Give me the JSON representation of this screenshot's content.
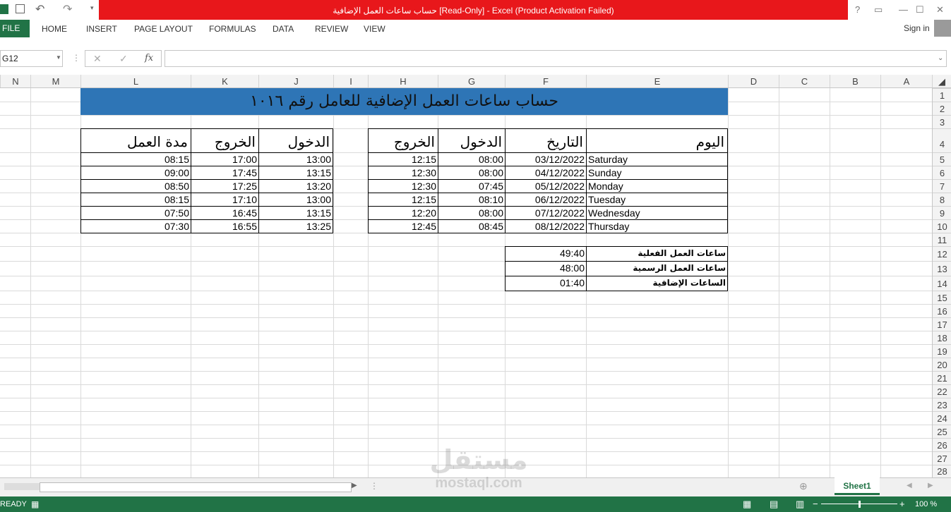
{
  "window": {
    "title": "حساب ساعات العمل الإضافية  [Read-Only]  -  Excel (Product Activation Failed)",
    "help": "?",
    "sign_in": "Sign in"
  },
  "ribbon": {
    "tabs": [
      "FILE",
      "HOME",
      "INSERT",
      "PAGE LAYOUT",
      "FORMULAS",
      "DATA",
      "REVIEW",
      "VIEW"
    ]
  },
  "formula_bar": {
    "name_box": "G12",
    "cancel_glyph": "✕",
    "enter_glyph": "✓",
    "fx_label": "fx",
    "value": ""
  },
  "columns": [
    "N",
    "M",
    "L",
    "K",
    "J",
    "I",
    "H",
    "G",
    "F",
    "E",
    "D",
    "C",
    "B",
    "A"
  ],
  "rows": [
    "1",
    "2",
    "3",
    "4",
    "5",
    "6",
    "7",
    "8",
    "9",
    "10",
    "11",
    "12",
    "13",
    "14",
    "15",
    "16",
    "17",
    "18",
    "19",
    "20",
    "21",
    "22",
    "23",
    "24",
    "25",
    "26",
    "27",
    "28"
  ],
  "sheet": {
    "banner": "حساب ساعات العمل الإضافية للعامل رقم ١٠١٦",
    "right_table": {
      "headers": [
        "اليوم",
        "التاريخ",
        "الدخول",
        "الخروج"
      ],
      "rows": [
        [
          "Saturday",
          "03/12/2022",
          "08:00",
          "12:15"
        ],
        [
          "Sunday",
          "04/12/2022",
          "08:00",
          "12:30"
        ],
        [
          "Monday",
          "05/12/2022",
          "07:45",
          "12:30"
        ],
        [
          "Tuesday",
          "06/12/2022",
          "08:10",
          "12:15"
        ],
        [
          "Wednesday",
          "07/12/2022",
          "08:00",
          "12:20"
        ],
        [
          "Thursday",
          "08/12/2022",
          "08:45",
          "12:45"
        ]
      ]
    },
    "left_table": {
      "headers": [
        "الدخول",
        "الخروج",
        "مدة العمل"
      ],
      "rows": [
        [
          "13:00",
          "17:00",
          "08:15"
        ],
        [
          "13:15",
          "17:45",
          "09:00"
        ],
        [
          "13:20",
          "17:25",
          "08:50"
        ],
        [
          "13:00",
          "17:10",
          "08:15"
        ],
        [
          "13:15",
          "16:45",
          "07:50"
        ],
        [
          "13:25",
          "16:55",
          "07:30"
        ]
      ]
    },
    "summary": [
      {
        "label": "ساعات العمل الفعلية",
        "value": "49:40"
      },
      {
        "label": "ساعات العمل الرسمية",
        "value": "48:00"
      },
      {
        "label": "الساعات الإضافية",
        "value": "01:40"
      }
    ]
  },
  "sheet_tab": "Sheet1",
  "status": {
    "ready": "READY",
    "zoom": "100 %"
  },
  "watermark": {
    "arabic": "مستقل",
    "latin": "mostaql.com"
  },
  "colors": {
    "title_bar": "#e8171b",
    "excel_green": "#217346",
    "banner_blue": "#2e75b6"
  }
}
